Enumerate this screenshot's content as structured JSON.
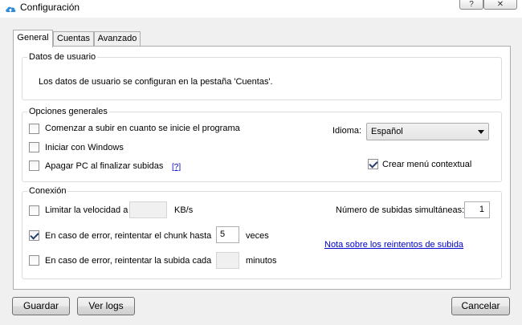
{
  "window": {
    "title": "Configuración",
    "help_label": "?",
    "close_label": "✕",
    "icon": "cloud-upload-icon"
  },
  "tabs": [
    {
      "label": "General",
      "active": true
    },
    {
      "label": "Cuentas",
      "active": false
    },
    {
      "label": "Avanzado",
      "active": false
    }
  ],
  "user_data": {
    "legend": "Datos de usuario",
    "message": "Los datos de usuario se configuran en la pestaña 'Cuentas'."
  },
  "general": {
    "legend": "Opciones generales",
    "start_upload": {
      "label": "Comenzar a subir en cuanto se inicie el programa",
      "checked": false
    },
    "start_with_windows": {
      "label": "Iniciar con Windows",
      "checked": false
    },
    "shutdown": {
      "label": "Apagar PC al finalizar subidas",
      "checked": false
    },
    "shutdown_help": "[?]",
    "language_label": "Idioma:",
    "language_value": "Español",
    "context_menu": {
      "label": "Crear menú contextual",
      "checked": true
    }
  },
  "connection": {
    "legend": "Conexión",
    "limit_speed": {
      "label": "Limitar la velocidad a",
      "checked": false,
      "value": "",
      "unit": "KB/s"
    },
    "simultaneous_label": "Número de subidas simultáneas:",
    "simultaneous_value": "1",
    "retry_chunk": {
      "label": "En caso de error, reintentar el chunk hasta",
      "checked": true,
      "value": "5",
      "unit": "veces"
    },
    "retry_note_link": "Nota sobre los reintentos de subida",
    "retry_upload": {
      "label": "En caso de error, reintentar la subida cada",
      "checked": false,
      "value": "",
      "unit": "minutos"
    }
  },
  "buttons": {
    "save": "Guardar",
    "view_logs": "Ver logs",
    "cancel": "Cancelar"
  }
}
